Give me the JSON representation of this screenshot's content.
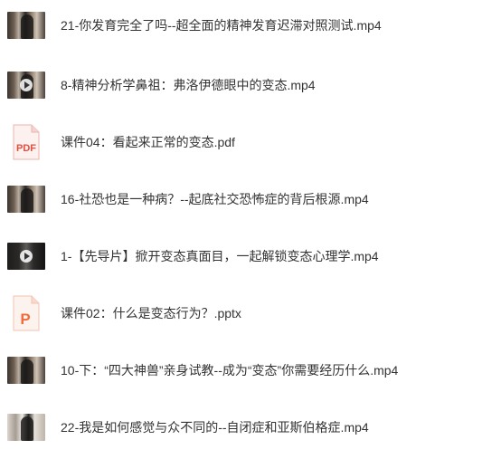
{
  "files": [
    {
      "name": "21-你发育完全了吗--超全面的精神发育迟滞对照测试.mp4",
      "type": "video",
      "icon": "video-thumbnail-icon"
    },
    {
      "name": "8-精神分析学鼻祖：弗洛伊德眼中的变态.mp4",
      "type": "video",
      "icon": "video-thumbnail-icon"
    },
    {
      "name": "课件04：看起来正常的变态.pdf",
      "type": "pdf",
      "icon": "pdf-file-icon",
      "badge": "PDF",
      "color": "#e84c3d"
    },
    {
      "name": "16-社恐也是一种病？--起底社交恐怖症的背后根源.mp4",
      "type": "video",
      "icon": "video-thumbnail-icon"
    },
    {
      "name": "1-【先导片】掀开变态真面目，一起解锁变态心理学.mp4",
      "type": "video",
      "icon": "video-thumbnail-icon"
    },
    {
      "name": "课件02：什么是变态行为？.pptx",
      "type": "pptx",
      "icon": "pptx-file-icon",
      "badge": "P",
      "color": "#f26b3a"
    },
    {
      "name": "10-下：“四大神兽”亲身试教--成为“变态”你需要经历什么.mp4",
      "type": "video",
      "icon": "video-thumbnail-icon"
    },
    {
      "name": "22-我是如何感觉与众不同的--自闭症和亚斯伯格症.mp4",
      "type": "video",
      "icon": "video-thumbnail-icon"
    }
  ]
}
